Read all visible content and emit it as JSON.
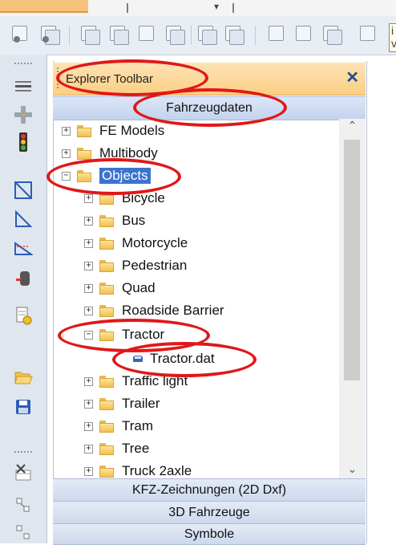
{
  "panel": {
    "title": "Explorer Toolbar",
    "close_glyph": "✕"
  },
  "tooltip": {
    "text": "i\nv"
  },
  "sections": {
    "active": "Fahrzeugdaten",
    "bottom": [
      "KFZ-Zeichnungen (2D Dxf)",
      "3D Fahrzeuge",
      "Symbole"
    ]
  },
  "tree": {
    "root_items": [
      {
        "label": "FE Models",
        "expander": "+",
        "icon": "folder-icon"
      },
      {
        "label": "Multibody",
        "expander": "+",
        "icon": "folder-icon"
      },
      {
        "label": "Objects",
        "expander": "−",
        "icon": "folder-open-icon",
        "selected": true
      }
    ],
    "object_children": [
      {
        "label": "Bicycle",
        "expander": "+"
      },
      {
        "label": "Bus",
        "expander": "+"
      },
      {
        "label": "Motorcycle",
        "expander": "+"
      },
      {
        "label": "Pedestrian",
        "expander": "+"
      },
      {
        "label": "Quad",
        "expander": "+"
      },
      {
        "label": "Roadside Barrier",
        "expander": "+"
      },
      {
        "label": "Tractor",
        "expander": "−"
      },
      {
        "label": "Traffic light",
        "expander": "+"
      },
      {
        "label": "Trailer",
        "expander": "+"
      },
      {
        "label": "Tram",
        "expander": "+"
      },
      {
        "label": "Tree",
        "expander": "+"
      },
      {
        "label": "Truck 2axle",
        "expander": "+"
      }
    ],
    "tractor_file": {
      "label": "Tractor.dat",
      "icon": "vehicle-file-icon"
    }
  },
  "colors": {
    "accent_orange": "#fbcf84",
    "section_blue": "#ccd8ec",
    "selection": "#3b74cf",
    "annotation_red": "#e01818"
  }
}
